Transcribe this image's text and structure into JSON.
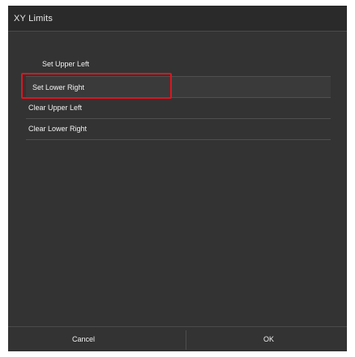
{
  "dialog": {
    "title": "XY Limits"
  },
  "menu": {
    "items": [
      {
        "label": "Set Upper Left"
      },
      {
        "label": "Set Lower Right"
      },
      {
        "label": "Clear Upper Left"
      },
      {
        "label": "Clear Lower Right"
      }
    ],
    "selected_index": 1
  },
  "footer": {
    "cancel_label": "Cancel",
    "ok_label": "OK"
  },
  "colors": {
    "dialog_background": "#333333",
    "highlight_border": "#e0141e",
    "text": "#f0f0f0"
  }
}
